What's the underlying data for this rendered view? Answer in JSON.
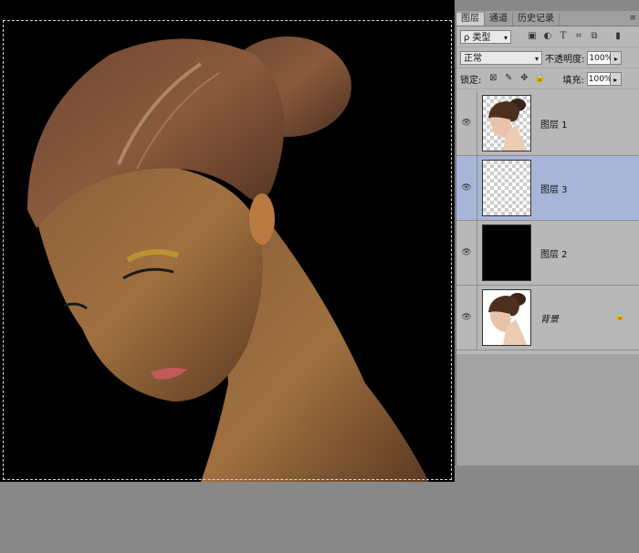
{
  "tabs": [
    {
      "label": "图层",
      "active": true
    },
    {
      "label": "通道",
      "active": false
    },
    {
      "label": "历史记录",
      "active": false
    }
  ],
  "filter": {
    "label": "ρ 类型"
  },
  "blend": {
    "mode": "正常",
    "opacity_label": "不透明度:",
    "opacity_value": "100%"
  },
  "lock": {
    "label": "锁定:",
    "fill_label": "填充:",
    "fill_value": "100%"
  },
  "layers": [
    {
      "name": "图层 1",
      "thumb": "portrait-transparent",
      "selected": false,
      "locked": false
    },
    {
      "name": "图层 3",
      "thumb": "transparent",
      "selected": true,
      "locked": false
    },
    {
      "name": "图层 2",
      "thumb": "black",
      "selected": false,
      "locked": false
    },
    {
      "name": "背景",
      "thumb": "portrait-white",
      "selected": false,
      "locked": true
    }
  ],
  "icons": {
    "filter_dropdown": "chevron-down-icon",
    "image_filter": "image-icon",
    "adjust_filter": "contrast-icon",
    "text_filter": "text-icon",
    "shape_filter": "shape-icon",
    "smart_filter": "smart-object-icon",
    "toggle": "toggle-icon",
    "eye": "eye-icon",
    "lock": "lock-icon"
  },
  "colors": {
    "selected_layer": "#a7b6d8",
    "panel_bg": "#b8b8b8",
    "canvas_bg": "#000000"
  }
}
